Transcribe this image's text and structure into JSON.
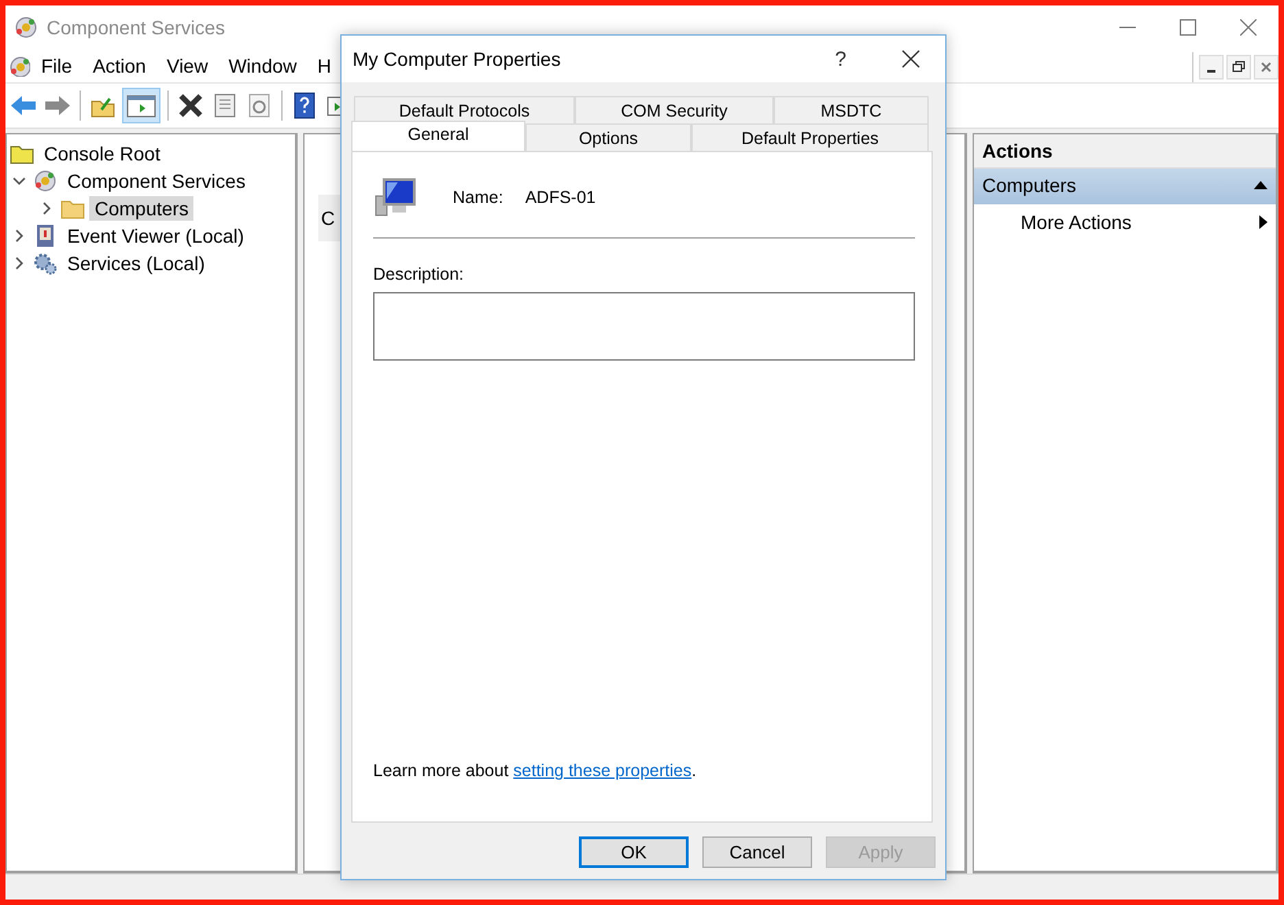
{
  "window": {
    "title": "Component Services"
  },
  "menu": [
    "File",
    "Action",
    "View",
    "Window",
    "H"
  ],
  "tree": {
    "root": "Console Root",
    "items": [
      {
        "label": "Component Services",
        "kind": "component",
        "expanded": true,
        "selected": false,
        "children": [
          {
            "label": "Computers",
            "kind": "folder",
            "expanded": false,
            "selected": true
          }
        ]
      },
      {
        "label": "Event Viewer (Local)",
        "kind": "event-viewer",
        "expanded": false,
        "selected": false
      },
      {
        "label": "Services (Local)",
        "kind": "services",
        "expanded": false,
        "selected": false
      }
    ]
  },
  "middle_pane": {
    "text": "C"
  },
  "actions": {
    "title": "Actions",
    "section": {
      "label": "Computers",
      "expanded": true
    },
    "items": [
      "More Actions"
    ]
  },
  "dialog": {
    "title": "My Computer Properties",
    "help": "?",
    "tab_rows": [
      [
        {
          "label": "Default Protocols",
          "selected": false
        },
        {
          "label": "COM Security",
          "selected": false
        },
        {
          "label": "MSDTC",
          "selected": false
        }
      ],
      [
        {
          "label": "General",
          "selected": true
        },
        {
          "label": "Options",
          "selected": false
        },
        {
          "label": "Default Properties",
          "selected": false
        }
      ]
    ],
    "name_label": "Name:",
    "name_value": "ADFS-01",
    "description_label": "Description:",
    "learn_more": {
      "text": "Learn more about ",
      "link": "setting these properties",
      "end": "."
    },
    "buttons": [
      {
        "label": "OK",
        "default": true,
        "disabled": false
      },
      {
        "label": "Cancel",
        "default": false,
        "disabled": false
      },
      {
        "label": "Apply",
        "default": false,
        "disabled": true
      }
    ]
  }
}
